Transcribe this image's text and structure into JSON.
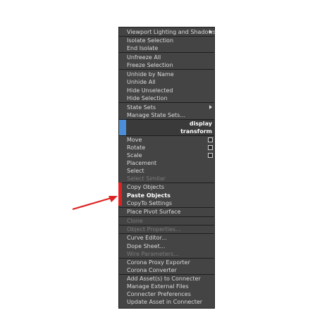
{
  "menu": {
    "items": [
      {
        "label": "Viewport Lighting and Shadows",
        "submenu": true
      },
      {
        "label": "Isolate Selection"
      },
      {
        "label": "End Isolate"
      },
      {
        "label": "Unfreeze All"
      },
      {
        "label": "Freeze Selection"
      },
      {
        "label": "Unhide by Name"
      },
      {
        "label": "Unhide All"
      },
      {
        "label": "Hide Unselected"
      },
      {
        "label": "Hide Selection"
      },
      {
        "label": "State Sets",
        "submenu": true
      },
      {
        "label": "Manage State Sets..."
      },
      {
        "label": "Move",
        "options": true
      },
      {
        "label": "Rotate",
        "options": true
      },
      {
        "label": "Scale",
        "options": true
      },
      {
        "label": "Placement"
      },
      {
        "label": "Select"
      },
      {
        "label": "Select Similar",
        "disabled": true
      },
      {
        "label": "Copy Objects"
      },
      {
        "label": "Paste Objects",
        "emphasized": true
      },
      {
        "label": "CopyTo Settings"
      },
      {
        "label": "Place Pivot Surface"
      },
      {
        "label": "Clone",
        "disabled": true
      },
      {
        "label": "Object Properties...",
        "disabled": true
      },
      {
        "label": "Curve Editor..."
      },
      {
        "label": "Dope Sheet..."
      },
      {
        "label": "Wire Parameters...",
        "disabled": true
      },
      {
        "label": "Corona Proxy Exporter"
      },
      {
        "label": "Corona Converter"
      },
      {
        "label": "Add Asset(s) to Connecter"
      },
      {
        "label": "Manage External Files"
      },
      {
        "label": "Connecter Preferences"
      },
      {
        "label": "Update Asset in Connecter"
      }
    ],
    "quad_labels": [
      {
        "label": "display",
        "color": "#4a8fd8"
      },
      {
        "label": "transform",
        "color": "#4a8fd8"
      }
    ]
  },
  "annotation": {
    "arrow_color": "#dd2222",
    "highlight_bar_color": "#dd2222"
  }
}
